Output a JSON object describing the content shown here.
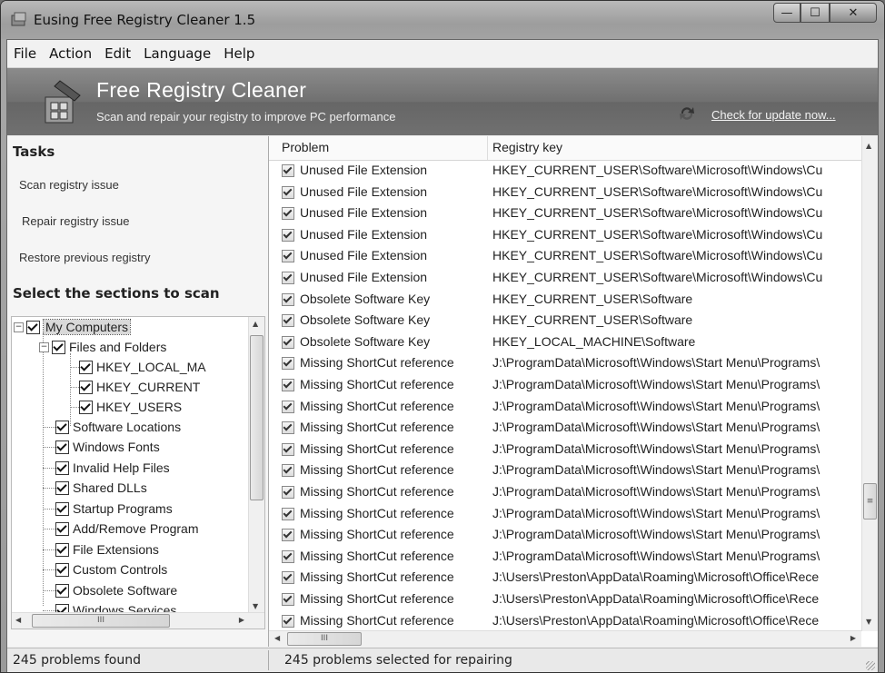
{
  "window": {
    "title": "Eusing Free Registry Cleaner 1.5"
  },
  "menu": [
    "File",
    "Action",
    "Edit",
    "Language",
    "Help"
  ],
  "banner": {
    "title": "Free Registry Cleaner",
    "subtitle": "Scan and repair your registry to improve PC performance",
    "update_link": "Check for update now..."
  },
  "tasks": {
    "heading": "Tasks",
    "items": [
      "Scan registry issue",
      "Repair registry issue",
      "Restore previous registry"
    ]
  },
  "sections": {
    "heading": "Select the sections to scan",
    "root": "My Computers",
    "files_and_folders": "Files and Folders",
    "hkeys": [
      "HKEY_LOCAL_MA",
      "HKEY_CURRENT",
      "HKEY_USERS"
    ],
    "items": [
      "Software Locations",
      "Windows Fonts",
      "Invalid Help Files",
      "Shared DLLs",
      "Startup Programs",
      "Add/Remove Program",
      "File Extensions",
      "Custom Controls",
      "Obsolete Software",
      "Windows Services"
    ]
  },
  "list": {
    "columns": [
      "Problem",
      "Registry key"
    ],
    "rows": [
      {
        "problem": "Unused File Extension",
        "key": "HKEY_CURRENT_USER\\Software\\Microsoft\\Windows\\Cu"
      },
      {
        "problem": "Unused File Extension",
        "key": "HKEY_CURRENT_USER\\Software\\Microsoft\\Windows\\Cu"
      },
      {
        "problem": "Unused File Extension",
        "key": "HKEY_CURRENT_USER\\Software\\Microsoft\\Windows\\Cu"
      },
      {
        "problem": "Unused File Extension",
        "key": "HKEY_CURRENT_USER\\Software\\Microsoft\\Windows\\Cu"
      },
      {
        "problem": "Unused File Extension",
        "key": "HKEY_CURRENT_USER\\Software\\Microsoft\\Windows\\Cu"
      },
      {
        "problem": "Unused File Extension",
        "key": "HKEY_CURRENT_USER\\Software\\Microsoft\\Windows\\Cu"
      },
      {
        "problem": "Obsolete Software Key",
        "key": "HKEY_CURRENT_USER\\Software"
      },
      {
        "problem": "Obsolete Software Key",
        "key": "HKEY_CURRENT_USER\\Software"
      },
      {
        "problem": "Obsolete Software Key",
        "key": "HKEY_LOCAL_MACHINE\\Software"
      },
      {
        "problem": "Missing ShortCut reference",
        "key": "J:\\ProgramData\\Microsoft\\Windows\\Start Menu\\Programs\\"
      },
      {
        "problem": "Missing ShortCut reference",
        "key": "J:\\ProgramData\\Microsoft\\Windows\\Start Menu\\Programs\\"
      },
      {
        "problem": "Missing ShortCut reference",
        "key": "J:\\ProgramData\\Microsoft\\Windows\\Start Menu\\Programs\\"
      },
      {
        "problem": "Missing ShortCut reference",
        "key": "J:\\ProgramData\\Microsoft\\Windows\\Start Menu\\Programs\\"
      },
      {
        "problem": "Missing ShortCut reference",
        "key": "J:\\ProgramData\\Microsoft\\Windows\\Start Menu\\Programs\\"
      },
      {
        "problem": "Missing ShortCut reference",
        "key": "J:\\ProgramData\\Microsoft\\Windows\\Start Menu\\Programs\\"
      },
      {
        "problem": "Missing ShortCut reference",
        "key": "J:\\ProgramData\\Microsoft\\Windows\\Start Menu\\Programs\\"
      },
      {
        "problem": "Missing ShortCut reference",
        "key": "J:\\ProgramData\\Microsoft\\Windows\\Start Menu\\Programs\\"
      },
      {
        "problem": "Missing ShortCut reference",
        "key": "J:\\ProgramData\\Microsoft\\Windows\\Start Menu\\Programs\\"
      },
      {
        "problem": "Missing ShortCut reference",
        "key": "J:\\ProgramData\\Microsoft\\Windows\\Start Menu\\Programs\\"
      },
      {
        "problem": "Missing ShortCut reference",
        "key": "J:\\Users\\Preston\\AppData\\Roaming\\Microsoft\\Office\\Rece"
      },
      {
        "problem": "Missing ShortCut reference",
        "key": "J:\\Users\\Preston\\AppData\\Roaming\\Microsoft\\Office\\Rece"
      },
      {
        "problem": "Missing ShortCut reference",
        "key": "J:\\Users\\Preston\\AppData\\Roaming\\Microsoft\\Office\\Rece"
      }
    ]
  },
  "status": {
    "found": "245 problems found",
    "selected": "245 problems selected for repairing"
  },
  "scroll_glyph": "III"
}
